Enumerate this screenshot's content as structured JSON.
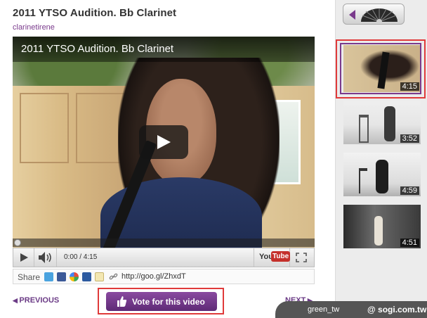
{
  "page": {
    "title": "2011 YTSO Audition. Bb Clarinet",
    "author": "clarinetirene"
  },
  "player": {
    "overlay_title": "2011 YTSO Audition. Bb Clarinet",
    "time": "0:00 / 4:15",
    "progress": 0,
    "logo_you": "You",
    "logo_tube": "Tube"
  },
  "share": {
    "label": "Share",
    "url": "http://goo.gl/ZhxdT",
    "icons": [
      "twitter-icon",
      "facebook-icon",
      "google-buzz-icon",
      "myspace-icon",
      "email-icon",
      "link-icon"
    ]
  },
  "nav": {
    "previous": "PREVIOUS",
    "next": "NEXT",
    "vote": "Vote for this video"
  },
  "playlist": {
    "items": [
      {
        "duration": "4:15",
        "selected": true
      },
      {
        "duration": "3:52",
        "selected": false
      },
      {
        "duration": "4:59",
        "selected": false
      },
      {
        "duration": "4:51",
        "selected": false
      }
    ]
  },
  "watermark": {
    "left": "green_tw",
    "right": "@ sogi.com.tw"
  },
  "colors": {
    "accent": "#7a3a8c",
    "highlight": "#e03a3a",
    "youtube_red": "#c4302b"
  }
}
